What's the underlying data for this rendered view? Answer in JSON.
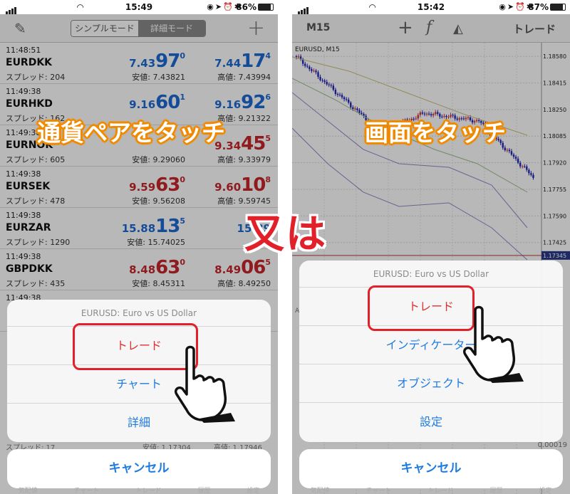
{
  "left": {
    "status": {
      "time": "15:49",
      "battery": "86%",
      "battery_level": 0.86
    },
    "nav": {
      "mode_simple": "シンプルモード",
      "mode_detail": "詳細モード"
    },
    "quotes": [
      {
        "time": "11:48:51",
        "symbol": "EURDKK",
        "spread": "スプレッド: 204",
        "color": "blue",
        "bid": {
          "small": "7.43",
          "big": "97",
          "sup": "0"
        },
        "ask": {
          "small": "7.44",
          "big": "17",
          "sup": "4"
        },
        "low": "安値: 7.43821",
        "high": "高値: 7.43994"
      },
      {
        "time": "11:49:38",
        "symbol": "EURHKD",
        "spread": "スプレッド: 162",
        "color": "blue",
        "bid": {
          "small": "9.16",
          "big": "60",
          "sup": "1"
        },
        "ask": {
          "small": "9.16",
          "big": "92",
          "sup": "6"
        },
        "low": "",
        "high": "高値: 9.21322"
      },
      {
        "time": "11:49:38",
        "symbol": "EURNOK",
        "spread": "スプレッド: 605",
        "color": "red",
        "bid": {
          "small": "",
          "big": "",
          "sup": ""
        },
        "ask": {
          "small": "9.34",
          "big": "45",
          "sup": "5"
        },
        "low": "安値: 9.29060",
        "high": "高値: 9.33979"
      },
      {
        "time": "11:49:38",
        "symbol": "EURSEK",
        "spread": "スプレッド: 478",
        "color": "red",
        "bid": {
          "small": "9.59",
          "big": "63",
          "sup": "0"
        },
        "ask": {
          "small": "9.60",
          "big": "10",
          "sup": "8"
        },
        "low": "安値: 9.56208",
        "high": "高値: 9.59745"
      },
      {
        "time": "11:49:38",
        "symbol": "EURZAR",
        "spread": "スプレッド: 1290",
        "color": "blue",
        "bid": {
          "small": "15.88",
          "big": "13",
          "sup": "5"
        },
        "ask": {
          "small": "15.89",
          "big": "",
          "sup": ""
        },
        "low": "安値: 15.74025",
        "high": ""
      },
      {
        "time": "11:49:38",
        "symbol": "GBPDKK",
        "spread": "スプレッド: 435",
        "color": "red",
        "bid": {
          "small": "8.48",
          "big": "63",
          "sup": "0"
        },
        "ask": {
          "small": "8.49",
          "big": "06",
          "sup": "5"
        },
        "low": "安値: 8.45311",
        "high": "高値: 8.49250"
      },
      {
        "time": "11:49:38",
        "symbol": "",
        "spread": "",
        "color": "blue",
        "bid": {
          "small": "",
          "big": "",
          "sup": ""
        },
        "ask": {
          "small": "",
          "big": "",
          "sup": ""
        },
        "low": "",
        "high": ""
      }
    ],
    "sheet": {
      "title": "EURUSD: Euro vs US Dollar",
      "items": [
        "トレード",
        "チャート",
        "詳細"
      ]
    },
    "cancel": "キャンセル",
    "peek_row": {
      "spread": "スプレッド: 17",
      "low": "安値: 1.17304",
      "high": "高値: 1.17946"
    },
    "tabs": [
      "気配値",
      "チャート",
      "トレード",
      "履歴",
      "設定"
    ]
  },
  "right": {
    "status": {
      "time": "15:42",
      "battery": "87%",
      "battery_level": 0.87
    },
    "nav": {
      "timeframe": "M15",
      "trade": "トレード"
    },
    "chart": {
      "label": "EURUSD, M15",
      "price_ticks": [
        "1.18580",
        "1.18415",
        "1.18250",
        "1.18085",
        "1.17920",
        "1.17755",
        "1.17590",
        "1.17425",
        "1.17345"
      ],
      "price_min": 1.1734,
      "price_max": 1.1862,
      "current_price": "1.17345",
      "bottom_tick": "0.00019",
      "bottom_left_label": "A"
    },
    "sheet": {
      "title": "EURUSD: Euro vs US Dollar",
      "items": [
        "トレード",
        "インディケーター",
        "オブジェクト",
        "設定"
      ]
    },
    "cancel": "キャンセル",
    "tabs": [
      "気配値",
      "チャート",
      "トレード",
      "履歴",
      "設定"
    ]
  },
  "captions": {
    "left": "通貨ペアをタッチ",
    "right": "画面をタッチ",
    "or": "又は"
  },
  "colors": {
    "accent_blue": "#1e7be0",
    "highlight_red": "#e2202a",
    "caption_orange": "#f08a00",
    "bid_blue": "#1e6ad4",
    "bid_red": "#c8262b"
  }
}
